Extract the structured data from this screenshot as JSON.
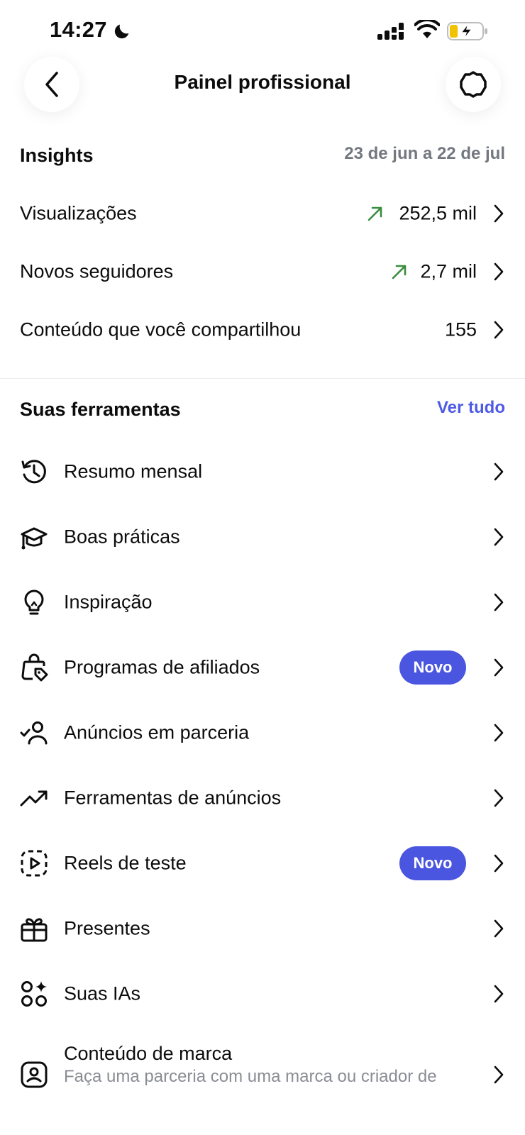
{
  "status_bar": {
    "time": "14:27"
  },
  "header": {
    "title": "Painel profissional"
  },
  "insights": {
    "title": "Insights",
    "date_range": "23 de jun a 22 de jul",
    "metrics": [
      {
        "label": "Visualizações",
        "value": "252,5 mil",
        "trend": "up"
      },
      {
        "label": "Novos seguidores",
        "value": "2,7 mil",
        "trend": "up"
      },
      {
        "label": "Conteúdo que você compartilhou",
        "value": "155",
        "trend": "none"
      }
    ]
  },
  "tools": {
    "title": "Suas ferramentas",
    "see_all": "Ver tudo",
    "items": [
      {
        "label": "Resumo mensal",
        "icon": "history-clock-icon"
      },
      {
        "label": "Boas práticas",
        "icon": "graduation-cap-icon"
      },
      {
        "label": "Inspiração",
        "icon": "lightbulb-icon"
      },
      {
        "label": "Programas de afiliados",
        "icon": "shopping-bag-tag-icon",
        "badge": "Novo"
      },
      {
        "label": "Anúncios em parceria",
        "icon": "person-check-icon"
      },
      {
        "label": "Ferramentas de anúncios",
        "icon": "trending-up-icon"
      },
      {
        "label": "Reels de teste",
        "icon": "reel-play-icon",
        "badge": "Novo"
      },
      {
        "label": "Presentes",
        "icon": "gift-icon"
      },
      {
        "label": "Suas IAs",
        "icon": "ai-sparkle-icon"
      },
      {
        "label": "Conteúdo de marca",
        "icon": "branded-content-icon",
        "subtitle": "Faça uma parceria com uma marca ou criador de"
      }
    ]
  },
  "colors": {
    "accent": "#4a55e0",
    "link": "#4d5ae6",
    "trend_up": "#3a8c3f",
    "muted": "#737780"
  }
}
